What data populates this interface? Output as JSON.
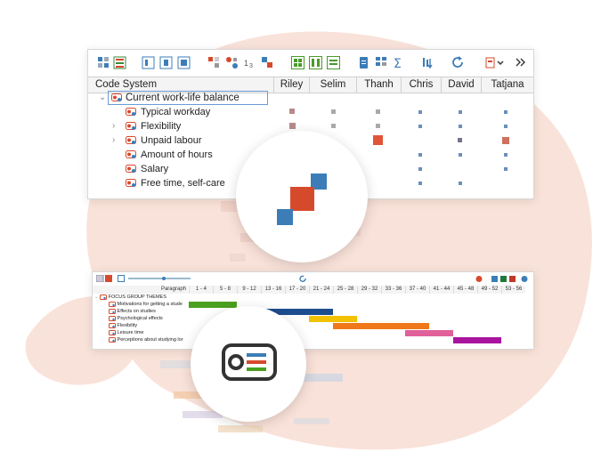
{
  "colors": {
    "accent_red": "#d64a2c",
    "accent_blue": "#3c7db8",
    "blob": "#f9e2d9",
    "cell": "#a9a9a9"
  },
  "matrix": {
    "header_label": "Code System",
    "columns": [
      "Riley",
      "Selim",
      "Thanh",
      "Chris",
      "David",
      "Tatjana"
    ],
    "rows": [
      {
        "label": "Current work-life balance",
        "icon": "code-icon",
        "expand": "open"
      },
      {
        "label": "Typical workday",
        "icon": "code-icon",
        "expand": ""
      },
      {
        "label": "Flexibility",
        "icon": "code-icon",
        "expand": "closed"
      },
      {
        "label": "Unpaid labour",
        "icon": "code-icon",
        "expand": "closed"
      },
      {
        "label": "Amount of hours",
        "icon": "code-icon",
        "expand": ""
      },
      {
        "label": "Salary",
        "icon": "code-icon",
        "expand": ""
      },
      {
        "label": "Free time, self-care",
        "icon": "code-icon",
        "expand": ""
      }
    ],
    "toolbar_icons": [
      "grid-toggle-icon",
      "color-grid-icon",
      "layout-a-icon",
      "layout-b-icon",
      "layout-c-icon",
      "symbol-a-icon",
      "symbol-b-icon",
      "sort-icon",
      "symbol-c-icon",
      "view-squares-icon",
      "view-columns-icon",
      "view-rows-icon",
      "document-icon",
      "table-icon",
      "sigma-icon",
      "sort-desc-icon",
      "refresh-icon",
      "export-icon",
      "more-icon"
    ]
  },
  "timeline": {
    "paragraph_label": "Paragraph",
    "ranges": [
      "1 - 4",
      "5 - 8",
      "9 - 12",
      "13 - 16",
      "17 - 20",
      "21 - 24",
      "25 - 28",
      "29 - 32",
      "33 - 36",
      "37 - 40",
      "41 - 44",
      "45 - 48",
      "49 - 52",
      "53 - 56"
    ],
    "group_label": "FOCUS GROUP THEMES",
    "rows": [
      {
        "label": "Motivations for getting a stude",
        "color": "#4aa020",
        "start": 1,
        "end": 2
      },
      {
        "label": "Effects on studies",
        "color": "#1d4d8f",
        "start": 4,
        "end": 6
      },
      {
        "label": "Psychological effects",
        "color": "#f2c200",
        "start": 6,
        "end": 7
      },
      {
        "label": "Flexibility",
        "color": "#f07818",
        "start": 7,
        "end": 10
      },
      {
        "label": "Leisure time",
        "color": "#e0609a",
        "start": 10,
        "end": 11
      },
      {
        "label": "Perceptions about studying lor",
        "color": "#a8149e",
        "start": 12,
        "end": 13
      }
    ]
  },
  "icons": {
    "center_top": "matrix-icon",
    "center_bottom": "document-lines-icon"
  }
}
